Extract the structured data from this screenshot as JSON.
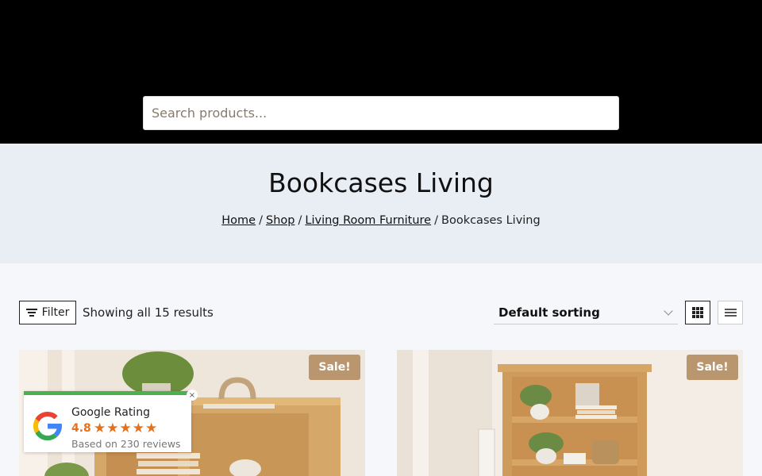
{
  "search": {
    "placeholder": "Search products..."
  },
  "page_title": "Bookcases Living",
  "breadcrumb": {
    "links": [
      "Home",
      "Shop",
      "Living Room Furniture"
    ],
    "current": "Bookcases Living",
    "separator": "/"
  },
  "toolbar": {
    "filter_label": "Filter",
    "result_count": "Showing all 15 results",
    "sort_selected": "Default sorting"
  },
  "products": [
    {
      "badge": "Sale!"
    },
    {
      "badge": "Sale!"
    }
  ],
  "google_rating": {
    "title": "Google Rating",
    "score": "4.8",
    "stars": "★★★★★",
    "reviews": "Based on 230 reviews",
    "close": "×"
  },
  "colors": {
    "header_bg": "#000000",
    "hero_bg": "#e9eef4",
    "sale_badge": "#b9966e",
    "star": "#e7711b",
    "rating_accent": "#4caf50"
  }
}
